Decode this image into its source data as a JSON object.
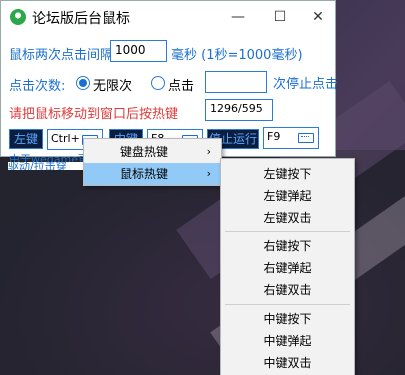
{
  "window": {
    "title": "论坛版后台鼠标",
    "minimize_glyph": "—",
    "maximize_glyph": "☐",
    "close_glyph": "✕"
  },
  "interval": {
    "label": "鼠标两次点击间隔",
    "value": "1000",
    "unit": "毫秒 (1秒=1000毫秒)"
  },
  "click_count": {
    "label": "点击次数:",
    "option_unlimited": "无限次",
    "option_clicks": "点击",
    "clicks_value": "",
    "suffix": "次停止点击"
  },
  "hint": {
    "text": "请把鼠标移动到窗口后按热键",
    "coords": "1296/595"
  },
  "hotkeys": {
    "left_btn": "左键",
    "left_hotkey": "Ctrl+",
    "middle_btn": "中键",
    "middle_hotkey": "F8",
    "stop_btn": "停止运行",
    "stop_hotkey": "F9"
  },
  "footer": {
    "line1": "由于wegame更",
    "line2": "驱动/拉击穿"
  },
  "context_menu": {
    "items": [
      {
        "label": "键盘热键",
        "arrow": "›"
      },
      {
        "label": "鼠标热键",
        "arrow": "›"
      }
    ]
  },
  "submenu": {
    "groups": [
      [
        "左键按下",
        "左键弹起",
        "左键双击"
      ],
      [
        "右键按下",
        "右键弹起",
        "右键双击"
      ],
      [
        "中键按下",
        "中键弹起",
        "中键双击"
      ]
    ]
  }
}
